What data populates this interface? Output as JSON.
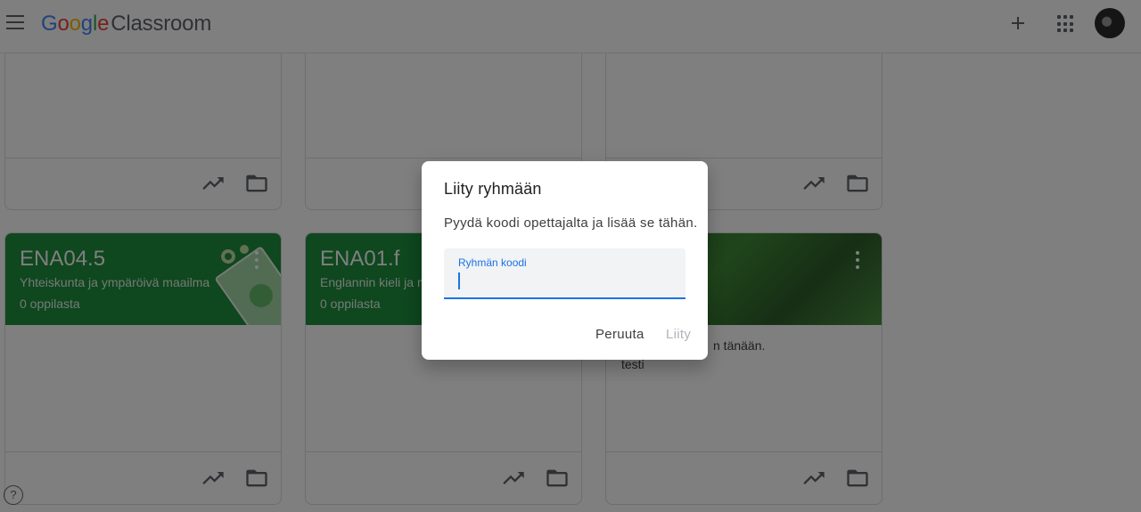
{
  "app": {
    "logo": {
      "brand_letters": [
        "G",
        "o",
        "o",
        "g",
        "l",
        "e"
      ],
      "product": "Classroom"
    },
    "header_icons": [
      "menu-icon",
      "plus-icon",
      "apps-icon",
      "avatar"
    ]
  },
  "cards_row1": [
    {
      "id": "card-1"
    },
    {
      "id": "card-2"
    },
    {
      "id": "card-3"
    }
  ],
  "cards_row2": [
    {
      "title": "ENA04.5",
      "subtitle": "Yhteiskunta ja ympäröivä maailma",
      "count": "0 oppilasta"
    },
    {
      "title": "ENA01.f",
      "subtitle": "Englannin kieli ja m",
      "count": "0 oppilasta"
    },
    {
      "title": "",
      "subtitle": "",
      "count": "",
      "announcement_line1": "n tänään.",
      "announcement_line2": "testi"
    }
  ],
  "dialog": {
    "title": "Liity ryhmään",
    "body": "Pyydä koodi opettajalta ja lisää se tähän.",
    "field_label": "Ryhmän koodi",
    "field_value": "",
    "cancel_label": "Peruuta",
    "join_label": "Liity"
  },
  "colors": {
    "green": "#1e8e3e",
    "accent": "#1a73e8"
  }
}
